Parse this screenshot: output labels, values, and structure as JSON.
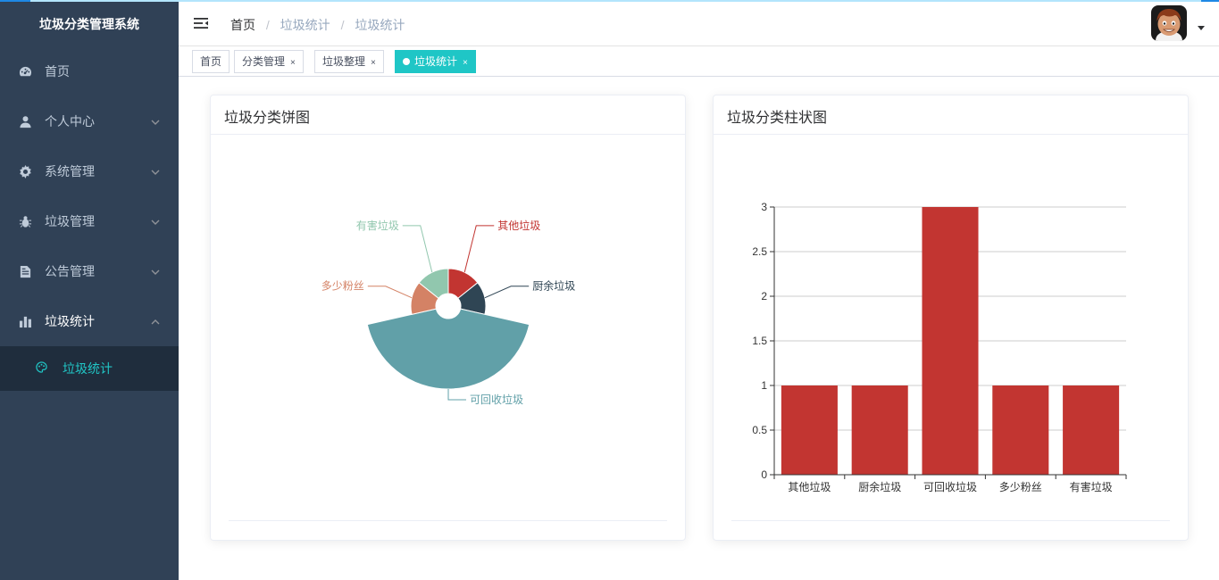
{
  "app": {
    "title": "垃圾分类管理系统"
  },
  "sidebar": {
    "items": [
      {
        "label": "首页",
        "icon": "dashboard-icon",
        "has_children": false
      },
      {
        "label": "个人中心",
        "icon": "user-icon",
        "has_children": true
      },
      {
        "label": "系统管理",
        "icon": "gear-icon",
        "has_children": true
      },
      {
        "label": "垃圾管理",
        "icon": "bug-icon",
        "has_children": true
      },
      {
        "label": "公告管理",
        "icon": "document-icon",
        "has_children": true
      },
      {
        "label": "垃圾统计",
        "icon": "bar-chart-icon",
        "has_children": true,
        "expanded": true
      }
    ],
    "sub_items": [
      {
        "label": "垃圾统计",
        "icon": "palette-icon",
        "active": true
      }
    ]
  },
  "navbar": {
    "breadcrumb": [
      "首页",
      "垃圾统计",
      "垃圾统计"
    ],
    "separator": "/"
  },
  "tags": [
    {
      "label": "首页",
      "closable": false,
      "active": false
    },
    {
      "label": "分类管理",
      "closable": true,
      "active": false
    },
    {
      "label": "垃圾整理",
      "closable": true,
      "active": false
    },
    {
      "label": "垃圾统计",
      "closable": true,
      "active": true
    }
  ],
  "tag_close": "×",
  "cards": {
    "pie_title": "垃圾分类饼图",
    "bar_title": "垃圾分类柱状图"
  },
  "chart_data": [
    {
      "type": "pie",
      "variant": "rose",
      "title": "垃圾分类饼图",
      "categories": [
        "其他垃圾",
        "厨余垃圾",
        "可回收垃圾",
        "多少粉丝",
        "有害垃圾"
      ],
      "values": [
        1,
        1,
        3,
        1,
        1
      ],
      "colors": [
        "#c23531",
        "#2f4554",
        "#61a0a8",
        "#d48265",
        "#91c7ae"
      ],
      "legend": "none"
    },
    {
      "type": "bar",
      "title": "垃圾分类柱状图",
      "categories": [
        "其他垃圾",
        "厨余垃圾",
        "可回收垃圾",
        "多少粉丝",
        "有害垃圾"
      ],
      "values": [
        1,
        1,
        3,
        1,
        1
      ],
      "ylim": [
        0,
        3
      ],
      "yticks": [
        "0",
        "0.5",
        "1",
        "1.5",
        "2",
        "2.5",
        "3"
      ],
      "ytick_values": [
        0,
        0.5,
        1,
        1.5,
        2,
        2.5,
        3
      ],
      "color": "#c23531",
      "grid": true,
      "xlabel": "",
      "ylabel": ""
    }
  ]
}
